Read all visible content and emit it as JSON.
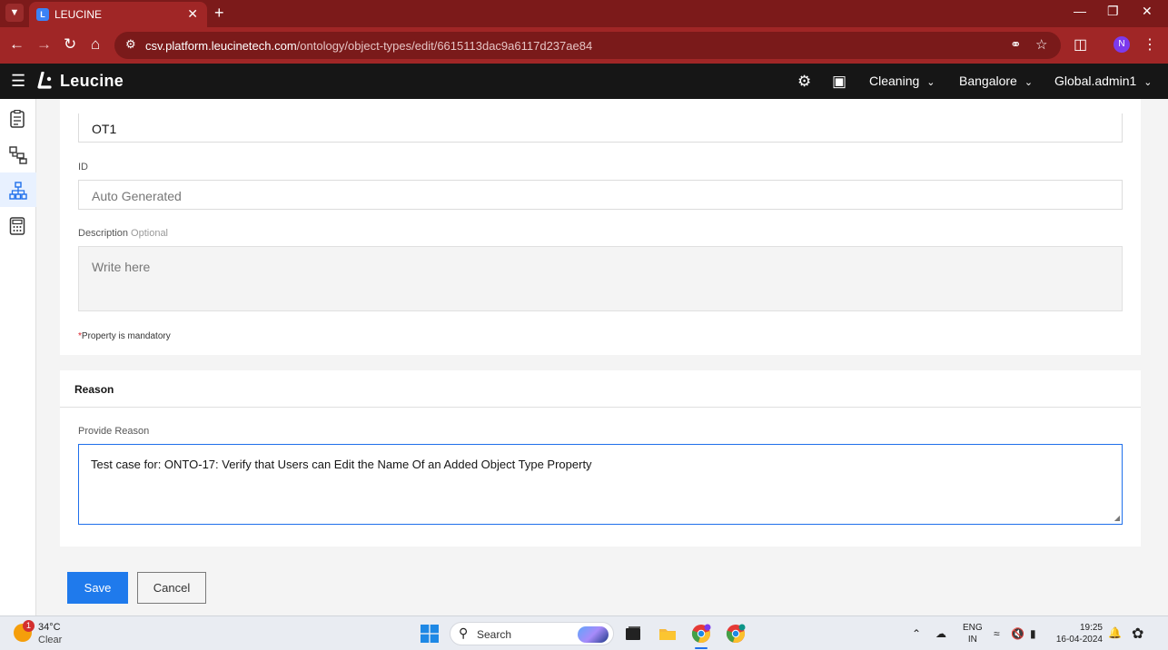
{
  "browser": {
    "tab_title": "LEUCINE",
    "tab_favicon": "L",
    "url_host": "csv.platform.leucinetech.com",
    "url_path": "/ontology/object-types/edit/6615113dac9a6117d237ae84",
    "profile_initial": "N",
    "colors": {
      "tabbar": "#7c1a1a",
      "toolbar": "#a02626"
    }
  },
  "header": {
    "brand": "Leucine",
    "facility": "Cleaning",
    "location": "Bangalore",
    "user": "Global.admin1"
  },
  "rail": {
    "icons": [
      "checklist-icon",
      "hierarchy-icon",
      "ontology-icon",
      "calculator-icon"
    ],
    "active_index": 2
  },
  "form": {
    "name_value": "OT1",
    "id_label": "ID",
    "id_placeholder": "Auto Generated",
    "description_label": "Description",
    "description_optional": "Optional",
    "description_placeholder": "Write here",
    "mandatory_star": "*",
    "mandatory_note": "Property is mandatory"
  },
  "reason": {
    "title": "Reason",
    "label": "Provide Reason",
    "value": "Test case for: ONTO-17: Verify that Users can Edit the Name Of an Added Object Type Property"
  },
  "actions": {
    "save": "Save",
    "cancel": "Cancel"
  },
  "taskbar": {
    "weather_temp": "34°C",
    "weather_cond": "Clear",
    "weather_badge": "1",
    "search": "Search",
    "lang_line1": "ENG",
    "lang_line2": "IN",
    "time": "19:25",
    "date": "16-04-2024"
  }
}
